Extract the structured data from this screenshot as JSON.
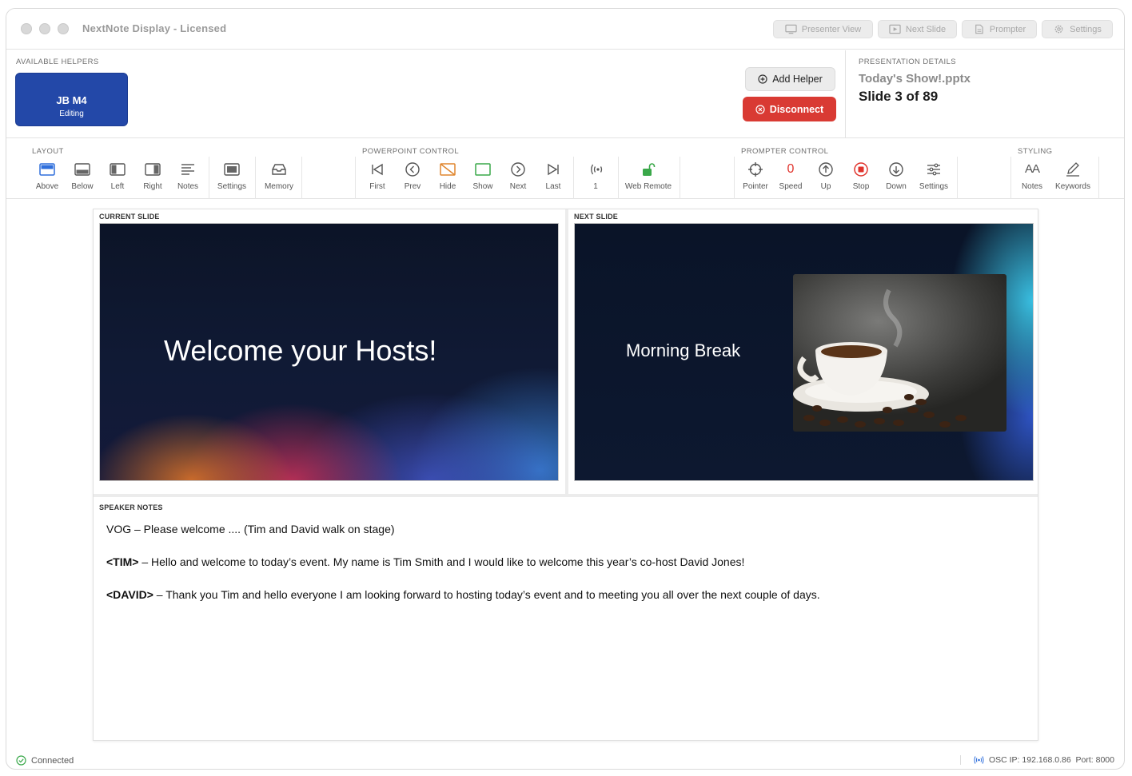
{
  "window": {
    "title": "NextNote Display - Licensed"
  },
  "titlebar": {
    "buttons": [
      "Presenter View",
      "Next Slide",
      "Prompter",
      "Settings"
    ]
  },
  "helpers": {
    "section_label": "AVAILABLE HELPERS",
    "items": [
      {
        "name": "JB M4",
        "status": "Editing"
      }
    ],
    "add_label": "Add Helper",
    "disconnect_label": "Disconnect"
  },
  "presentation": {
    "section_label": "PRESENTATION DETAILS",
    "file": "Today's Show!.pptx",
    "slide_info": "Slide 3 of 89"
  },
  "toolbar": {
    "layout": {
      "label": "LAYOUT",
      "items": [
        "Above",
        "Below",
        "Left",
        "Right",
        "Notes",
        "Settings",
        "Memory"
      ]
    },
    "powerpoint": {
      "label": "POWERPOINT CONTROL",
      "items": [
        "First",
        "Prev",
        "Hide",
        "Show",
        "Next",
        "Last",
        "1",
        "Web Remote"
      ]
    },
    "prompter": {
      "label": "PROMPTER CONTROL",
      "speed_value": "0",
      "items": [
        "Pointer",
        "Speed",
        "Up",
        "Stop",
        "Down",
        "Settings"
      ]
    },
    "styling": {
      "label": "STYLING",
      "notes_glyph": "AA",
      "items": [
        "Notes",
        "Keywords"
      ]
    }
  },
  "current_slide": {
    "label": "CURRENT SLIDE",
    "text": "Welcome your Hosts!"
  },
  "next_slide": {
    "label": "NEXT SLIDE",
    "text": "Morning Break"
  },
  "notes": {
    "label": "SPEAKER NOTES",
    "line1": "VOG – Please welcome .... (Tim and David walk on stage)",
    "line2_tag": "<TIM>",
    "line2_text": " – Hello and welcome to today’s event. My name is Tim Smith and I would like to welcome this year’s co-host David Jones!",
    "line3_tag": "<DAVID>",
    "line3_text": " – Thank you Tim and hello everyone I am looking forward to hosting today’s event and to meeting you all over the next couple of days."
  },
  "status": {
    "connection": "Connected",
    "osc": "OSC IP: 192.168.0.86  Port: 8000"
  },
  "colors": {
    "accent_blue": "#2f6fdc",
    "helper_card": "#2348a8",
    "disconnect": "#d93a33",
    "hide_orange": "#e0862e",
    "show_green": "#3aa84a",
    "remote_green": "#3aa84a",
    "prompter_red": "#e0322b"
  }
}
